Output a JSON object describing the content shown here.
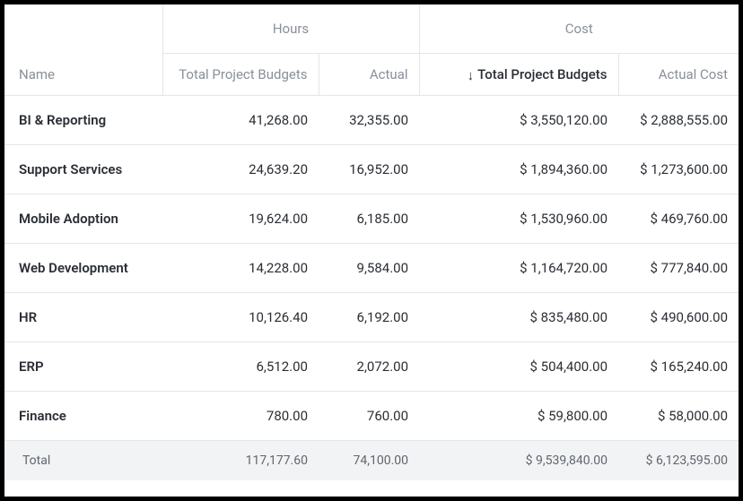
{
  "headers": {
    "name": "Name",
    "hours_group": "Hours",
    "cost_group": "Cost",
    "hours_budget": "Total Project Budgets",
    "hours_actual": "Actual",
    "cost_budget": "Total Project Budgets",
    "cost_actual": "Actual Cost"
  },
  "rows": [
    {
      "name": "BI & Reporting",
      "hours_budget": "41,268.00",
      "hours_actual": "32,355.00",
      "cost_budget": "$ 3,550,120.00",
      "cost_actual": "$ 2,888,555.00"
    },
    {
      "name": "Support Services",
      "hours_budget": "24,639.20",
      "hours_actual": "16,952.00",
      "cost_budget": "$ 1,894,360.00",
      "cost_actual": "$ 1,273,600.00"
    },
    {
      "name": "Mobile Adoption",
      "hours_budget": "19,624.00",
      "hours_actual": "6,185.00",
      "cost_budget": "$ 1,530,960.00",
      "cost_actual": "$ 469,760.00"
    },
    {
      "name": "Web Development",
      "hours_budget": "14,228.00",
      "hours_actual": "9,584.00",
      "cost_budget": "$ 1,164,720.00",
      "cost_actual": "$ 777,840.00"
    },
    {
      "name": "HR",
      "hours_budget": "10,126.40",
      "hours_actual": "6,192.00",
      "cost_budget": "$ 835,480.00",
      "cost_actual": "$ 490,600.00"
    },
    {
      "name": "ERP",
      "hours_budget": "6,512.00",
      "hours_actual": "2,072.00",
      "cost_budget": "$ 504,400.00",
      "cost_actual": "$ 165,240.00"
    },
    {
      "name": "Finance",
      "hours_budget": "780.00",
      "hours_actual": "760.00",
      "cost_budget": "$ 59,800.00",
      "cost_actual": "$ 58,000.00"
    }
  ],
  "totals": {
    "label": "Total",
    "hours_budget": "117,177.60",
    "hours_actual": "74,100.00",
    "cost_budget": "$ 9,539,840.00",
    "cost_actual": "$ 6,123,595.00"
  },
  "sort": {
    "column": "cost_budget",
    "direction_icon": "↓"
  }
}
